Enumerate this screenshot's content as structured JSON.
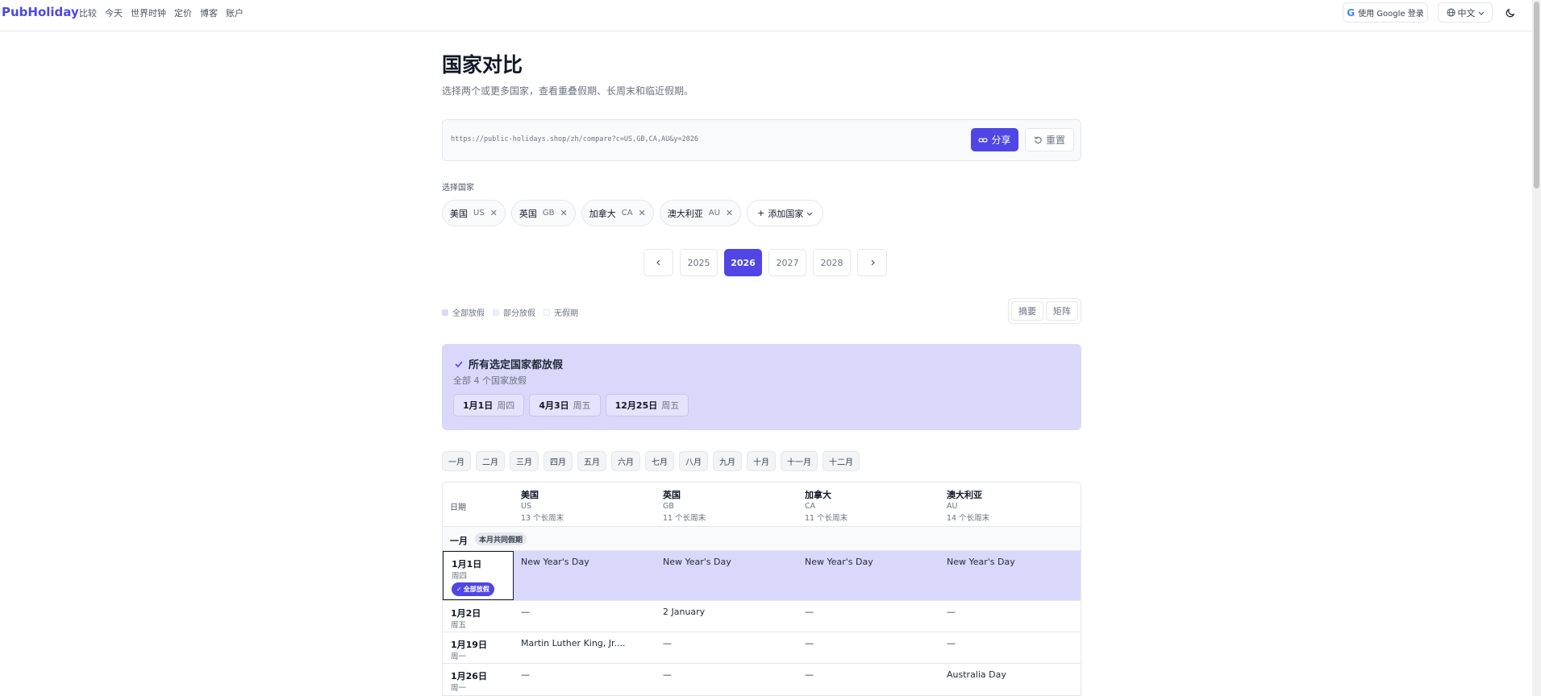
{
  "nav": {
    "brand": "PubHoliday",
    "links": [
      "比较",
      "今天",
      "世界时钟",
      "定价",
      "博客",
      "账户"
    ],
    "google_signin": "使用 Google 登录",
    "language": "中文"
  },
  "page": {
    "title": "国家对比",
    "subtitle": "选择两个或更多国家，查看重叠假期、长周末和临近假期。"
  },
  "share": {
    "url": "https://public-holidays.shop/zh/compare?c=US,GB,CA,AU&y=2026",
    "share_label": "分享",
    "reset_label": "重置"
  },
  "selection": {
    "label": "选择国家",
    "countries": [
      {
        "name": "美国",
        "code": "US"
      },
      {
        "name": "英国",
        "code": "GB"
      },
      {
        "name": "加拿大",
        "code": "CA"
      },
      {
        "name": "澳大利亚",
        "code": "AU"
      }
    ],
    "add_label": "添加国家"
  },
  "years": {
    "options": [
      "2025",
      "2026",
      "2027",
      "2028"
    ],
    "selected": "2026"
  },
  "legend": {
    "items": [
      {
        "label": "全部放假",
        "color": "#d9d8fb"
      },
      {
        "label": "部分放假",
        "color": "#eceefe"
      },
      {
        "label": "无假期",
        "color": "#ffffff"
      }
    ]
  },
  "view_toggle": {
    "summary": "摘要",
    "matrix": "矩阵"
  },
  "all_off": {
    "title": "所有选定国家都放假",
    "subtitle": "全部 4 个国家放假",
    "dates": [
      {
        "date": "1月1日",
        "weekday": "周四"
      },
      {
        "date": "4月3日",
        "weekday": "周五"
      },
      {
        "date": "12月25日",
        "weekday": "周五"
      }
    ]
  },
  "months": [
    "一月",
    "二月",
    "三月",
    "四月",
    "五月",
    "六月",
    "七月",
    "八月",
    "九月",
    "十月",
    "十一月",
    "十二月"
  ],
  "table": {
    "date_header": "日期",
    "columns": [
      {
        "name": "美国",
        "code": "US",
        "weekends": "13 个长周末"
      },
      {
        "name": "英国",
        "code": "GB",
        "weekends": "11 个长周末"
      },
      {
        "name": "加拿大",
        "code": "CA",
        "weekends": "11 个长周末"
      },
      {
        "name": "澳大利亚",
        "code": "AU",
        "weekends": "14 个长周末"
      }
    ],
    "month_label": "一月",
    "month_badge": "本月共同假期",
    "all_badge": "全部放假",
    "rows": [
      {
        "date": "1月1日",
        "weekday": "周四",
        "all": true,
        "cells": [
          "New Year's Day",
          "New Year's Day",
          "New Year's Day",
          "New Year's Day"
        ]
      },
      {
        "date": "1月2日",
        "weekday": "周五",
        "all": false,
        "cells": [
          "—",
          "2 January",
          "—",
          "—"
        ]
      },
      {
        "date": "1月19日",
        "weekday": "周一",
        "all": false,
        "cells": [
          "Martin Luther King, Jr....",
          "—",
          "—",
          "—"
        ]
      },
      {
        "date": "1月26日",
        "weekday": "周一",
        "all": false,
        "cells": [
          "—",
          "—",
          "—",
          "Australia Day"
        ]
      }
    ]
  },
  "colors": {
    "accent": "#4f46e5",
    "highlight": "#d9d8fb"
  }
}
